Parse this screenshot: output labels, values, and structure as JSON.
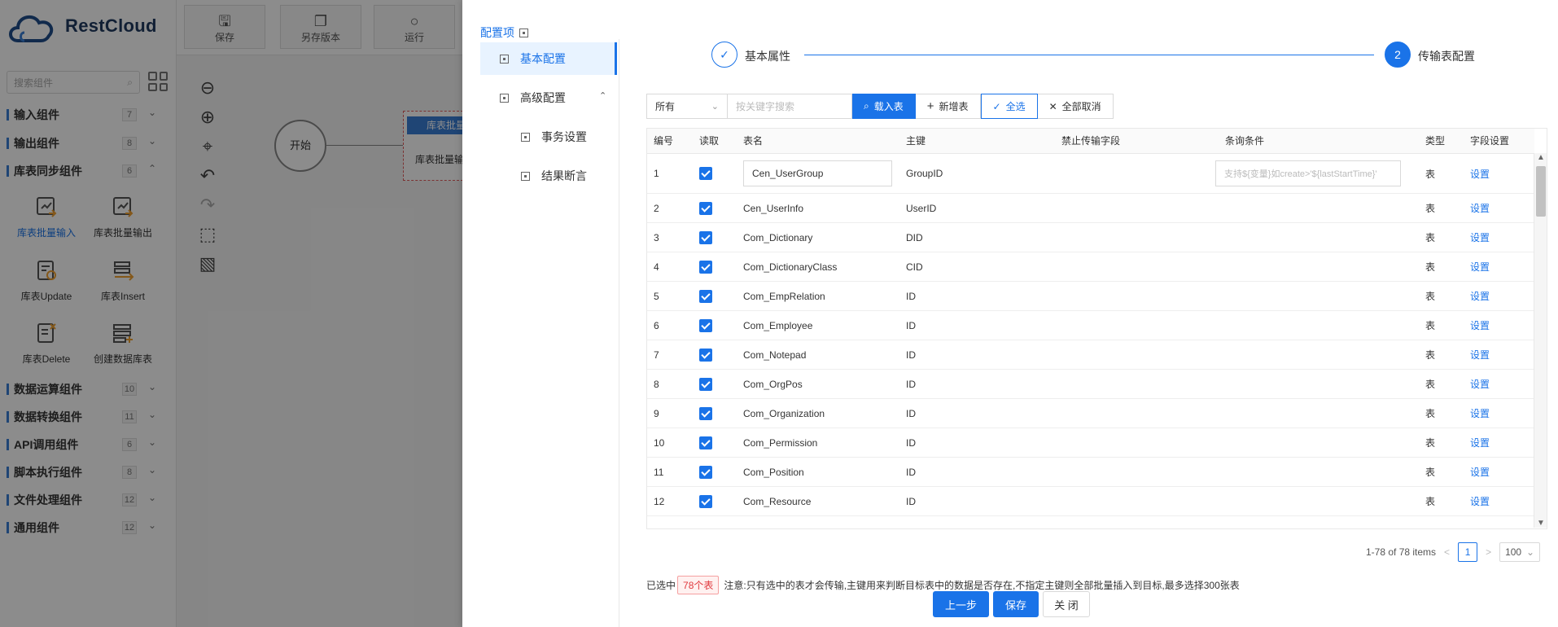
{
  "app": {
    "brand": "RestCloud",
    "search_placeholder": "搜索组件",
    "toolbar": [
      {
        "label": "保存",
        "icon": "save-icon"
      },
      {
        "label": "另存版本",
        "icon": "copy-icon"
      },
      {
        "label": "运行",
        "icon": "run-icon"
      }
    ],
    "categories": [
      {
        "label": "输入组件",
        "count": "7"
      },
      {
        "label": "输出组件",
        "count": "8"
      },
      {
        "label": "库表同步组件",
        "count": "6"
      },
      {
        "label": "数据运算组件",
        "count": "10"
      },
      {
        "label": "数据转换组件",
        "count": "11"
      },
      {
        "label": "API调用组件",
        "count": "6"
      },
      {
        "label": "脚本执行组件",
        "count": "8"
      },
      {
        "label": "文件处理组件",
        "count": "12"
      },
      {
        "label": "通用组件",
        "count": "12"
      }
    ],
    "components": [
      {
        "label": "库表批量输入"
      },
      {
        "label": "库表批量输出"
      },
      {
        "label": "库表Update"
      },
      {
        "label": "库表Insert"
      },
      {
        "label": "库表Delete"
      },
      {
        "label": "创建数据库表"
      }
    ],
    "canvas": {
      "start_label": "开始",
      "node_header": "库表批量",
      "node_label": "库表批量输"
    }
  },
  "drawer": {
    "config_header": "配置项",
    "menu": [
      {
        "label": "基本配置"
      },
      {
        "label": "高级配置"
      },
      {
        "label": "事务设置"
      },
      {
        "label": "结果断言"
      }
    ],
    "steps": [
      {
        "number": "✓",
        "label": "基本属性"
      },
      {
        "number": "2",
        "label": "传输表配置"
      }
    ],
    "filter_select": "所有",
    "keyword_placeholder": "按关键字搜索",
    "buttons": {
      "load": "载入表",
      "add": "新增表",
      "select_all": "全选",
      "cancel_all": "全部取消"
    },
    "columns": [
      "编号",
      "读取",
      "表名",
      "主键",
      "禁止传输字段",
      "条询条件",
      "类型",
      "字段设置"
    ],
    "rows": [
      {
        "no": "1",
        "name": "Cen_UserGroup",
        "pk": "GroupID",
        "type": "表",
        "action": "设置"
      },
      {
        "no": "2",
        "name": "Cen_UserInfo",
        "pk": "UserID",
        "type": "表",
        "action": "设置"
      },
      {
        "no": "3",
        "name": "Com_Dictionary",
        "pk": "DID",
        "type": "表",
        "action": "设置"
      },
      {
        "no": "4",
        "name": "Com_DictionaryClass",
        "pk": "CID",
        "type": "表",
        "action": "设置"
      },
      {
        "no": "5",
        "name": "Com_EmpRelation",
        "pk": "ID",
        "type": "表",
        "action": "设置"
      },
      {
        "no": "6",
        "name": "Com_Employee",
        "pk": "ID",
        "type": "表",
        "action": "设置"
      },
      {
        "no": "7",
        "name": "Com_Notepad",
        "pk": "ID",
        "type": "表",
        "action": "设置"
      },
      {
        "no": "8",
        "name": "Com_OrgPos",
        "pk": "ID",
        "type": "表",
        "action": "设置"
      },
      {
        "no": "9",
        "name": "Com_Organization",
        "pk": "ID",
        "type": "表",
        "action": "设置"
      },
      {
        "no": "10",
        "name": "Com_Permission",
        "pk": "ID",
        "type": "表",
        "action": "设置"
      },
      {
        "no": "11",
        "name": "Com_Position",
        "pk": "ID",
        "type": "表",
        "action": "设置"
      },
      {
        "no": "12",
        "name": "Com_Resource",
        "pk": "ID",
        "type": "表",
        "action": "设置"
      }
    ],
    "condition_placeholder": "支持${变量}如create>'${lastStartTime}'",
    "pagination": {
      "summary": "1-78 of 78 items",
      "page": "1",
      "page_size": "100"
    },
    "note": {
      "prefix": "已选中",
      "badge": "78个表",
      "text": "注意:只有选中的表才会传输,主键用来判断目标表中的数据是否存在,不指定主键则全部批量插入到目标,最多选择300张表"
    },
    "footer": {
      "prev": "上一步",
      "save": "保存",
      "close": "关 闭"
    }
  },
  "colors": {
    "primary": "#1a73e8",
    "badge": "#e0393e",
    "overlay": "rgba(0,0,0,0.45)"
  }
}
